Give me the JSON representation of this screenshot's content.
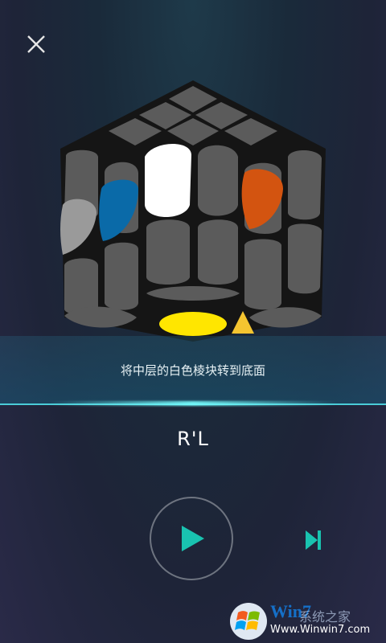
{
  "header": {
    "close_icon": "close-icon"
  },
  "guide": {
    "instruction": "将中层的白色棱块转到底面",
    "move_notation": "R'L"
  },
  "controls": {
    "play_icon": "play-icon",
    "next_icon": "skip-next-icon"
  },
  "cube": {
    "highlighted_stickers": [
      "white",
      "blue",
      "orange",
      "gray",
      "yellow"
    ],
    "colors": {
      "white": "#ffffff",
      "blue": "#0a6aa8",
      "orange": "#d35410",
      "gray": "#9a9a9a",
      "yellow": "#ffe600",
      "hidden": "#5b5b5b",
      "body": "#1a1a1a",
      "arrow": "#f4c430"
    }
  },
  "watermark": {
    "brand": "Win7",
    "subtitle": "Www.Winwin7.com",
    "suffix": "系统之家"
  },
  "theme": {
    "accent": "#19c3b0",
    "banner_line": "#5adfe6"
  }
}
